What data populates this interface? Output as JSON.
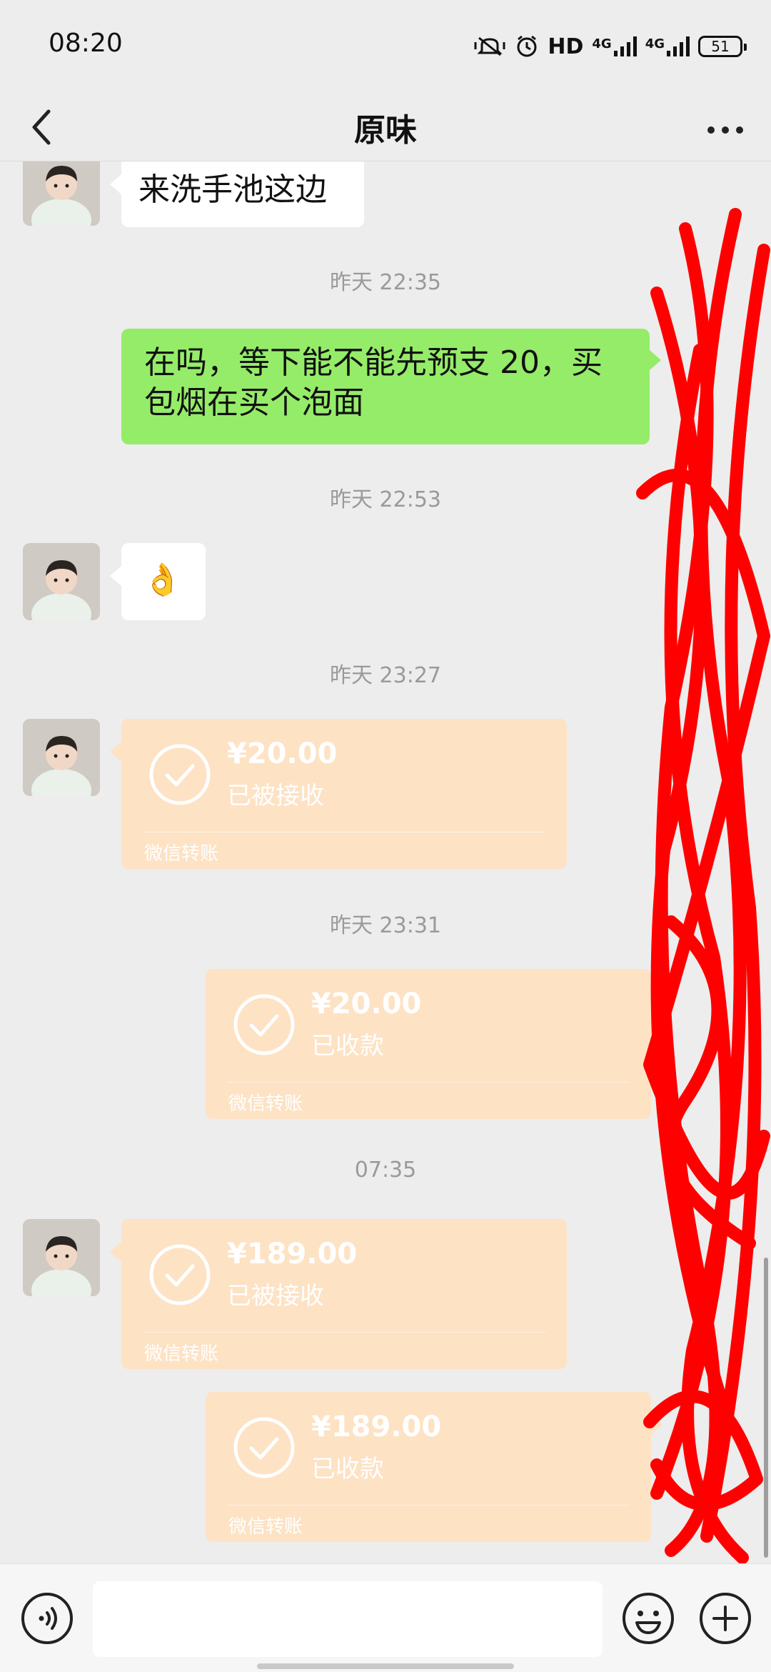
{
  "status_bar": {
    "time": "08:20",
    "network_label": "HD",
    "net1": "4G",
    "net2": "4G",
    "battery": "51"
  },
  "header": {
    "title": "原味"
  },
  "messages": {
    "m1": {
      "text": "来洗手池这边"
    },
    "t1": "昨天 22:35",
    "m2": {
      "text_line1": "在吗，等下能不能先预支 20，买",
      "text_line2": "包烟在买个泡面"
    },
    "t2": "昨天 22:53",
    "m3": {
      "text": "👌"
    },
    "t3": "昨天 23:27",
    "tr1": {
      "amount": "¥20.00",
      "status": "已被接收",
      "footer": "微信转账"
    },
    "t4": "昨天 23:31",
    "tr2": {
      "amount": "¥20.00",
      "status": "已收款",
      "footer": "微信转账"
    },
    "t5": "07:35",
    "tr3": {
      "amount": "¥189.00",
      "status": "已被接收",
      "footer": "微信转账"
    },
    "tr4": {
      "amount": "¥189.00",
      "status": "已收款",
      "footer": "微信转账"
    }
  },
  "colors": {
    "green_bubble": "#95ec69",
    "transfer_bg": "#fde2c4",
    "scribble": "#ff0000"
  },
  "icons": [
    "back-icon",
    "more-icon",
    "voice-icon",
    "emoji-icon",
    "plus-icon",
    "check-icon"
  ]
}
